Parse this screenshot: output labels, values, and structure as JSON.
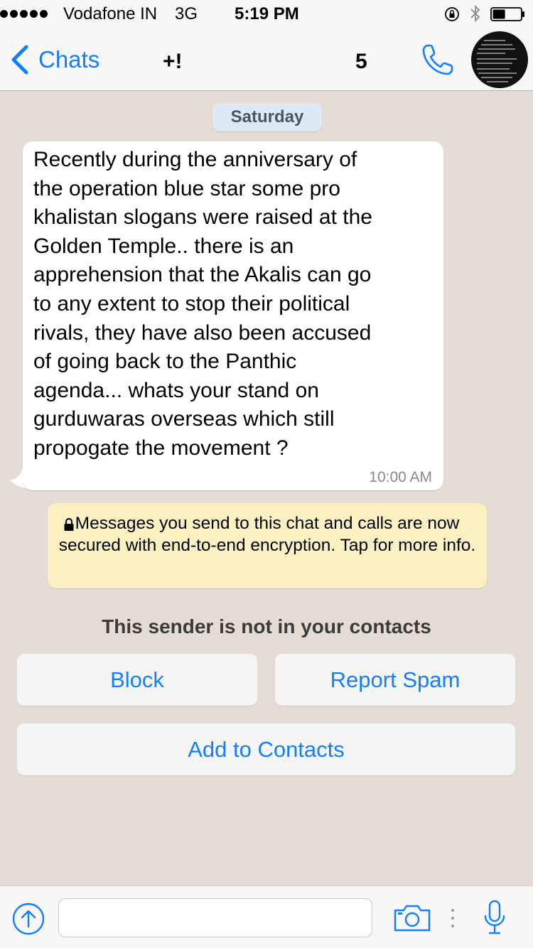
{
  "status_bar": {
    "signal_dots": 5,
    "carrier": "Vodafone IN",
    "network": "3G",
    "time": "5:19 PM",
    "battery_level": 0.45
  },
  "nav": {
    "back_label": "Chats",
    "contact_name_start": "+!",
    "contact_name_end": "5"
  },
  "chat": {
    "date_label": "Saturday",
    "messages": [
      {
        "text": "Recently during the anniversary of\nthe operation blue star some pro\nkhalistan slogans were raised at the\nGolden Temple.. there is an\napprehension that the Akalis can go\nto any extent to stop their political\nrivals, they have also been accused\nof going back to the Panthic\nagenda... whats your stand on\ngurduwaras overseas which still\npropogate the movement ?",
        "time": "10:00 AM"
      }
    ],
    "encryption_notice": "Messages you send to this chat and calls are now secured with end-to-end encryption. Tap for more info."
  },
  "unknown_sender": {
    "notice": "This sender is not in your contacts",
    "block_label": "Block",
    "report_label": "Report Spam",
    "add_label": "Add to Contacts"
  },
  "input_bar": {
    "message_value": "",
    "placeholder": ""
  },
  "colors": {
    "accent": "#157efb",
    "chat_background": "#e5ddd5",
    "notice_background": "#fbf0c1",
    "date_pill": "#dde9f4"
  },
  "icons": [
    "signal-icon",
    "rotation-lock-icon",
    "bluetooth-icon",
    "battery-icon",
    "chevron-left-icon",
    "phone-icon",
    "lock-icon",
    "upload-icon",
    "camera-icon",
    "more-icon",
    "microphone-icon"
  ]
}
